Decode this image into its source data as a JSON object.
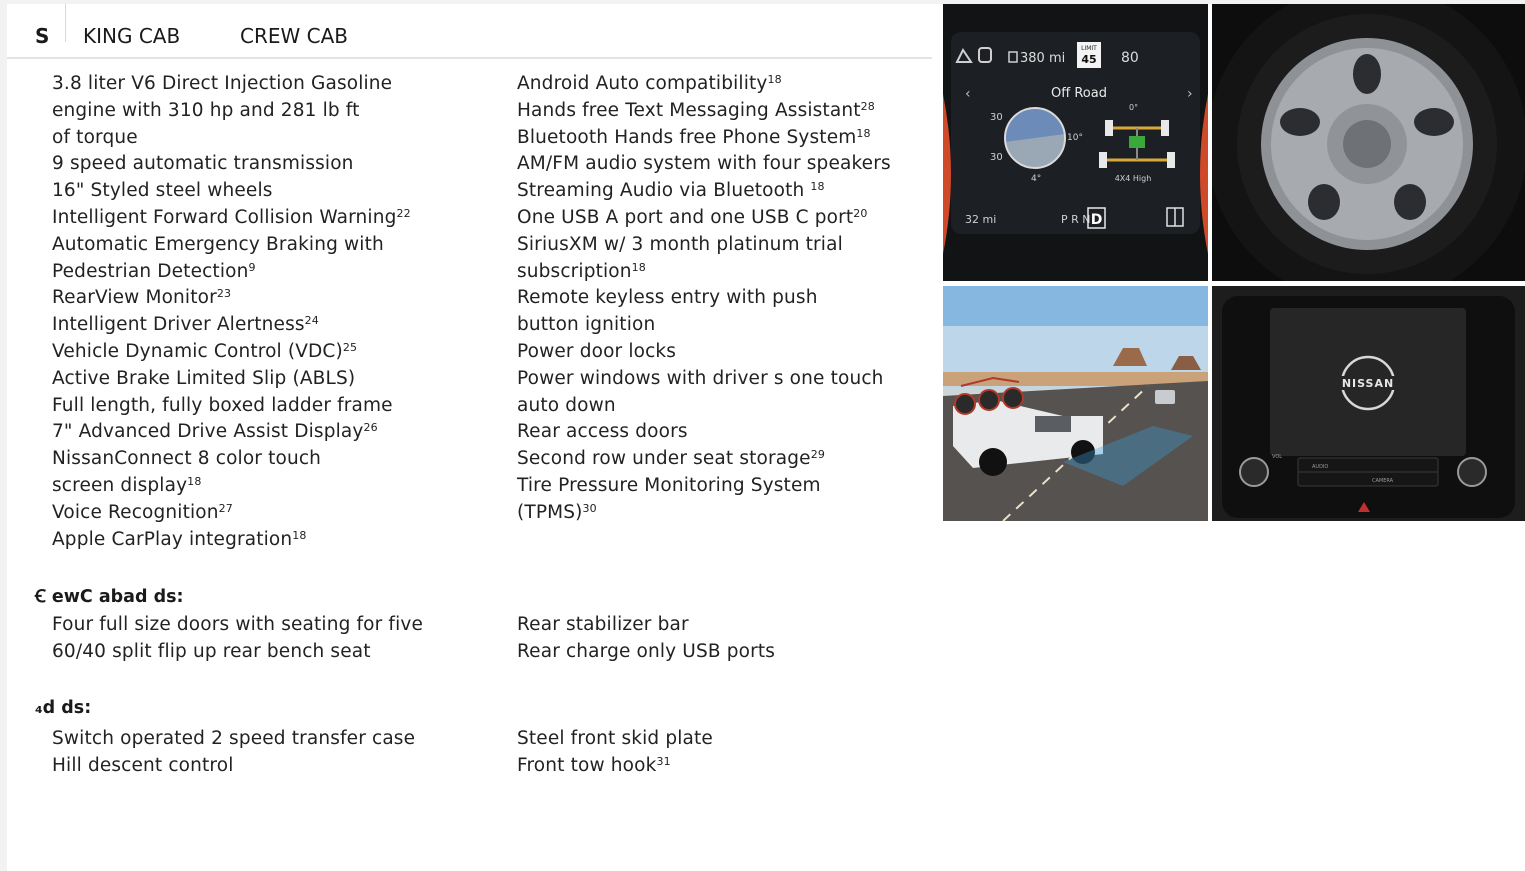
{
  "tabs": [
    "S",
    "KING CAB",
    "CREW CAB"
  ],
  "left_column": [
    [
      "3.8 liter V6 Direct Injection Gasoline",
      ""
    ],
    [
      "engine with 310 hp and 281 lb  ft",
      ""
    ],
    [
      "of torque",
      ""
    ],
    [
      "9  speed automatic transmission",
      ""
    ],
    [
      "16\" Styled steel wheels",
      ""
    ],
    [
      "Intelligent Forward Collision Warning",
      "22"
    ],
    [
      "Automatic Emergency Braking with",
      ""
    ],
    [
      "Pedestrian Detection",
      "9"
    ],
    [
      "RearView Monitor",
      "23"
    ],
    [
      "Intelligent Driver Alertness",
      "24"
    ],
    [
      "Vehicle Dynamic Control (VDC)",
      "25"
    ],
    [
      "Active Brake Limited Slip (ABLS)",
      ""
    ],
    [
      "Full  length, fully boxed ladder frame",
      ""
    ],
    [
      "7\" Advanced Drive  Assist   Display",
      "26"
    ],
    [
      "NissanConnect   8   color touch",
      ""
    ],
    [
      "screen display",
      "18"
    ],
    [
      "Voice Recognition",
      "27"
    ],
    [
      "Apple CarPlay   integration",
      "18"
    ]
  ],
  "right_column": [
    [
      "Android Auto   compatibility",
      "18"
    ],
    [
      "Hands  free Text Messaging Assistant",
      "28"
    ],
    [
      "Bluetooth   Hands  free Phone System",
      "18"
    ],
    [
      "AM/FM audio system with four speakers",
      ""
    ],
    [
      "Streaming Audio via Bluetooth  ",
      "18"
    ],
    [
      "One USB  A port and one USB  C port",
      "20"
    ],
    [
      "SiriusXM w/  3  month platinum trial",
      ""
    ],
    [
      "subscription",
      "18"
    ],
    [
      "Remote keyless entry with push",
      ""
    ],
    [
      "button ignition",
      ""
    ],
    [
      "Power door locks",
      ""
    ],
    [
      "Power windows with driver s one  touch",
      ""
    ],
    [
      "auto  down",
      ""
    ],
    [
      "Rear access doors",
      ""
    ],
    [
      "Second  row under  seat storage",
      "29"
    ],
    [
      "Tire Pressure Monitoring System",
      ""
    ],
    [
      "(TPMS)",
      "30"
    ]
  ],
  "crew_heading": "Ꞓ ewC abad ds:",
  "crew_left": [
    [
      "Four full  size doors with seating for five",
      ""
    ],
    [
      "60/40  split flip  up rear bench seat",
      ""
    ]
  ],
  "crew_right": [
    [
      "Rear stabilizer bar",
      ""
    ],
    [
      "Rear charge  only USB ports",
      ""
    ]
  ],
  "fourx4_heading": "₄d       ds:",
  "fourx4_left": [
    [
      "Switch  operated 2  speed transfer case",
      ""
    ],
    [
      "Hill descent control",
      ""
    ]
  ],
  "fourx4_right": [
    [
      "Steel front skid plate",
      ""
    ],
    [
      "Front tow hook",
      "31"
    ]
  ],
  "cluster": {
    "range": "380 mi",
    "limit_label": "LIMIT",
    "limit_value": "45",
    "speed": "80",
    "mode": "Off Road",
    "pitch_top": "30",
    "pitch_bottom": "30",
    "roll": "4°",
    "tilt": "10°",
    "zero": "0°",
    "drive_mode": "4X4 High",
    "trip": "32 mi",
    "gears": "P R N",
    "gear_selected": "D"
  },
  "infotainment": {
    "logo": "NISSAN",
    "vol": "VOL",
    "buttons": [
      "AUDIO",
      "CAMERA",
      "",
      "",
      "",
      "",
      ""
    ]
  },
  "colors": {
    "cluster_accent": "#d04a2a",
    "gauge_green": "#3aa83a"
  }
}
